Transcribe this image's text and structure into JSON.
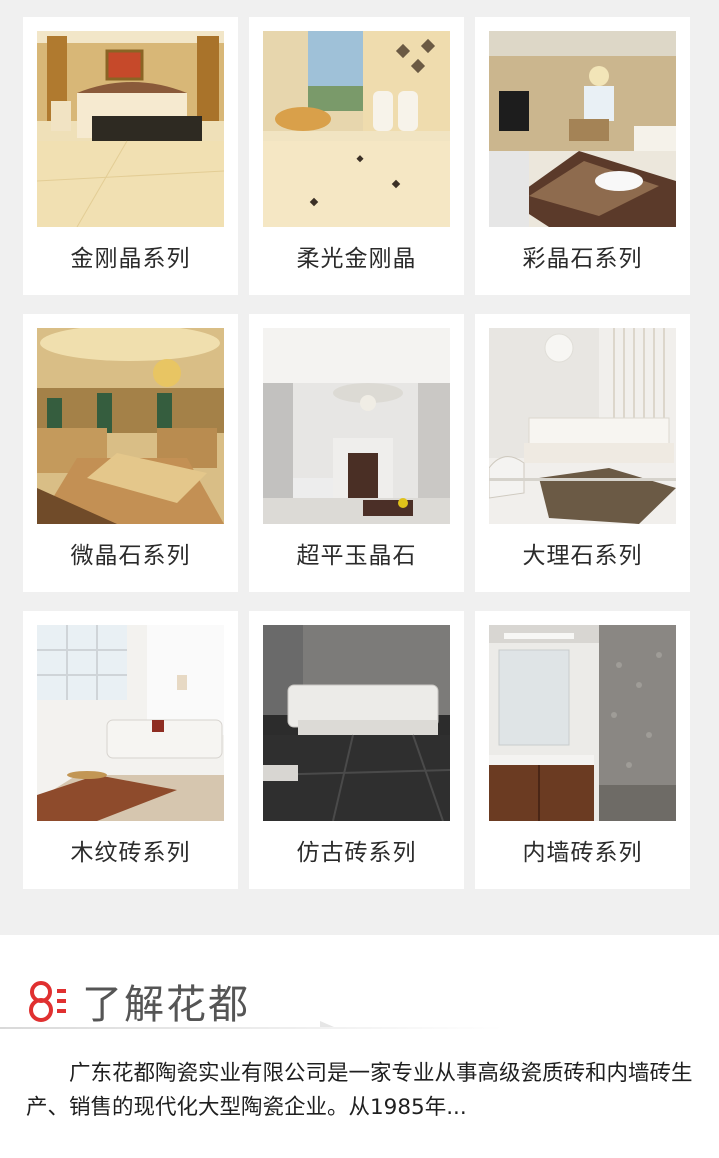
{
  "products": [
    {
      "label": "金刚晶系列",
      "image": "bedroom-marble"
    },
    {
      "label": "柔光金刚晶",
      "image": "dining-onyx"
    },
    {
      "label": "彩晶石系列",
      "image": "living-carpet"
    },
    {
      "label": "微晶石系列",
      "image": "luxury-hall"
    },
    {
      "label": "超平玉晶石",
      "image": "modern-living"
    },
    {
      "label": "大理石系列",
      "image": "white-sofa"
    },
    {
      "label": "木纹砖系列",
      "image": "loft-room"
    },
    {
      "label": "仿古砖系列",
      "image": "dark-stone-room"
    },
    {
      "label": "内墙砖系列",
      "image": "bathroom"
    }
  ],
  "about": {
    "title": "了解花都",
    "icon": "brand-logo-icon",
    "text": "广东花都陶瓷实业有限公司是一家专业从事高级瓷质砖和内墙砖生产、销售的现代化大型陶瓷企业。从1985年..."
  },
  "colors": {
    "accent": "#e03030",
    "page_bg": "#f0f0f0",
    "card_bg": "#ffffff"
  }
}
